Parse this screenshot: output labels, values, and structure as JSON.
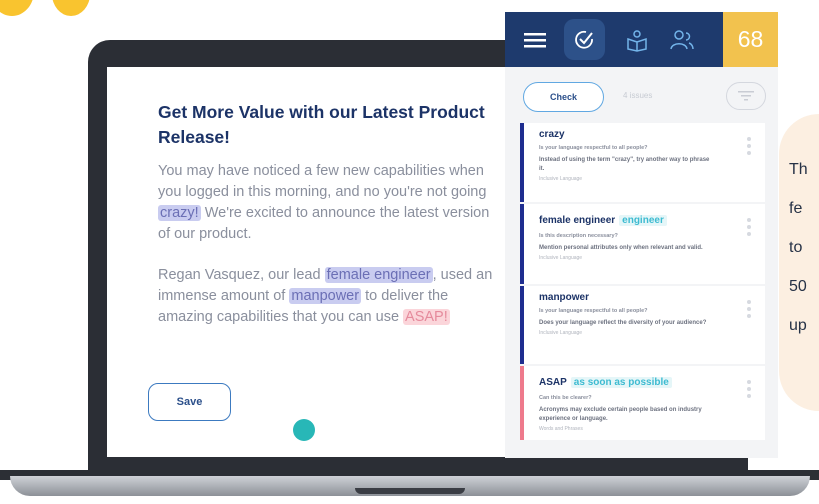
{
  "editor": {
    "heading": "Get More Value with our Latest Product Release!",
    "p1_a": "You may have noticed a few new capabilities when you logged in this morning, and no you're not going",
    "p1_hl": "crazy!",
    "p1_b": "We're excited to announce the latest version of our product.",
    "p2_a": "Regan Vasquez, our lead",
    "p2_hl1": "female engineer",
    "p2_b": ", used an immense amount of",
    "p2_hl2": "manpower",
    "p2_c": "to deliver the amazing capabilities that you can use",
    "p2_hl3": "ASAP!",
    "save_label": "Save"
  },
  "panel": {
    "score": "68",
    "check_label": "Check",
    "issues_label": "4 issues",
    "cards": [
      {
        "term": "crazy",
        "alt": "",
        "question": "Is your language respectful to all people?",
        "detail": "Instead of using the term \"crazy\", try another way to phrase it.",
        "category": "Inclusive Language"
      },
      {
        "term": "female engineer",
        "alt": "engineer",
        "question": "Is this description necessary?",
        "detail": "Mention personal attributes only when relevant and valid.",
        "category": "Inclusive Language"
      },
      {
        "term": "manpower",
        "alt": "",
        "question": "Is your language respectful to all people?",
        "detail": "Does your language reflect the diversity of your audience?",
        "category": "Inclusive Language"
      },
      {
        "term": "ASAP",
        "alt": "as soon as possible",
        "question": "Can this be clearer?",
        "detail": "Acronyms may exclude certain people based on industry experience or language.",
        "category": "Words and Phrases"
      }
    ]
  },
  "callout": {
    "lines": [
      "Th",
      "fe",
      "to",
      "50",
      "up"
    ]
  },
  "colors": {
    "brand_dark": "#1e3a6d",
    "score_yellow": "#f2c24e",
    "accent_teal": "#28b7b7",
    "highlight_purple": "#c9ccf0",
    "highlight_pink": "#fbd5da"
  }
}
